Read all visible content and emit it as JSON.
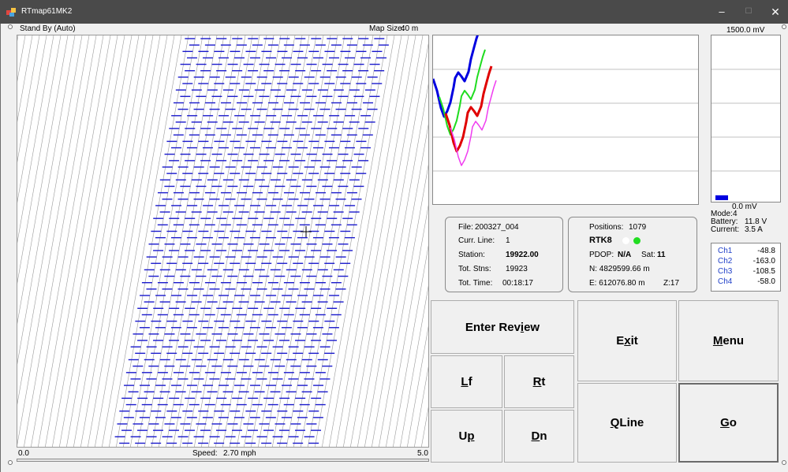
{
  "window": {
    "title": "RTmap61MK2",
    "controls": {
      "minimize": "–",
      "maximize": "☐",
      "close": "✕"
    }
  },
  "header": {
    "status": "Stand By (Auto)",
    "map_size_label": "Map Size:",
    "map_size_value": "40 m"
  },
  "map": {
    "x_min_label": "0.0",
    "x_max_label": "5.0",
    "speed_label": "Speed:",
    "speed_value": "2.70 mph"
  },
  "voltage": {
    "max_label": "1500.0 mV",
    "min_label": "0.0 mV",
    "max_mv": 1500,
    "level_mv": 45
  },
  "status": {
    "mode_label": "Mode:",
    "mode_value": "4",
    "battery_label": "Battery:",
    "battery_value": "11.8 V",
    "current_label": "Current:",
    "current_value": "3.5 A"
  },
  "channels": [
    {
      "label": "Ch1",
      "value": "-48.8"
    },
    {
      "label": "Ch2",
      "value": "-163.0"
    },
    {
      "label": "Ch3",
      "value": "-108.5"
    },
    {
      "label": "Ch4",
      "value": "-58.0"
    }
  ],
  "file_info": {
    "file_label": "File:",
    "file_value": "200327_004",
    "curr_line_label": "Curr. Line:",
    "curr_line_value": "1",
    "station_label": "Station:",
    "station_value": "19922.00",
    "tot_stns_label": "Tot. Stns:",
    "tot_stns_value": "19923",
    "tot_time_label": "Tot. Time:",
    "tot_time_value": "00:18:17"
  },
  "gps_info": {
    "positions_label": "Positions:",
    "positions_value": "1079",
    "fix_type": "RTK8",
    "pdop_label": "PDOP:",
    "pdop_value": "N/A",
    "sat_label": "Sat:",
    "sat_value": "11",
    "north": "N: 4829599.66 m",
    "east": "E: 612076.80 m",
    "zone": "Z:17"
  },
  "buttons": {
    "enter_review": {
      "pre": "Enter Rev",
      "mn": "i",
      "post": "ew"
    },
    "exit": {
      "pre": "E",
      "mn": "x",
      "post": "it"
    },
    "menu": {
      "pre": "",
      "mn": "M",
      "post": "enu"
    },
    "lf": {
      "pre": "",
      "mn": "L",
      "post": "f"
    },
    "rt": {
      "pre": "",
      "mn": "R",
      "post": "t"
    },
    "up": {
      "pre": "U",
      "mn": "p",
      "post": ""
    },
    "dn": {
      "pre": "",
      "mn": "D",
      "post": "n"
    },
    "qline": {
      "pre": "",
      "mn": "Q",
      "post": "Line"
    },
    "go": {
      "pre": "",
      "mn": "G",
      "post": "o"
    }
  },
  "colors": {
    "titlebar": "#4a4a4a",
    "track": "#1a1acc",
    "ch_blue": "#0000e0",
    "ch_green": "#1fdc1f",
    "ch_red": "#e00000",
    "ch_magenta": "#f03cf0",
    "gps_led_inactive": "#ffffff",
    "gps_led_active": "#22dd22",
    "channel_label": "#2040c8"
  }
}
